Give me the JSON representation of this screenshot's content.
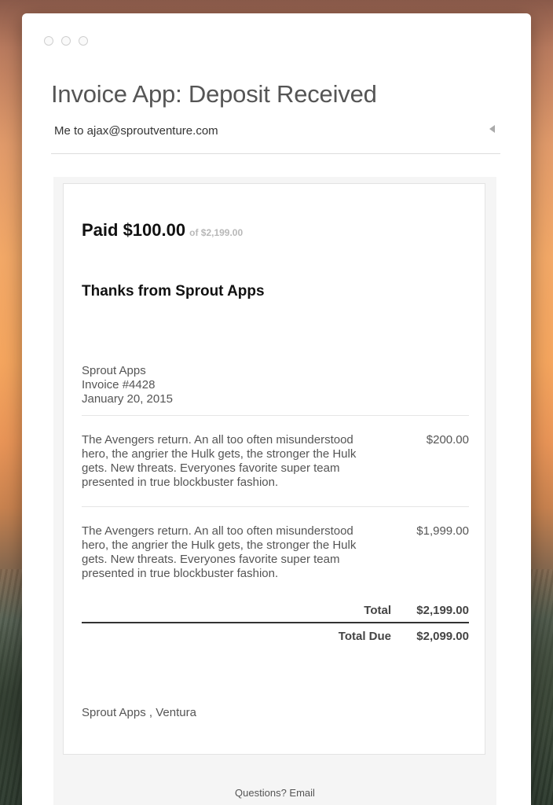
{
  "email": {
    "subject": "Invoice App: Deposit Received",
    "from_line": "Me to ajax@sproutventure.com"
  },
  "invoice": {
    "paid_amount": "Paid $100.00",
    "paid_of": "of $2,199.00",
    "thanks": "Thanks from Sprout Apps",
    "company": "Sprout Apps",
    "invoice_number": "Invoice #4428",
    "date": "January 20, 2015",
    "items": [
      {
        "description": "The Avengers return. An all too often misunderstood hero, the angrier the Hulk gets, the stronger the Hulk gets. New threats. Everyones favorite super team presented in true blockbuster fashion.",
        "price": "$200.00"
      },
      {
        "description": "The Avengers return. An all too often misunderstood hero, the angrier the Hulk gets, the stronger the Hulk gets. New threats. Everyones favorite super team presented in true blockbuster fashion.",
        "price": "$1,999.00"
      }
    ],
    "total_label": "Total",
    "total_value": "$2,199.00",
    "total_due_label": "Total Due",
    "total_due_value": "$2,099.00",
    "footer_company": "Sprout Apps , Ventura"
  },
  "footer": {
    "questions": "Questions? Email"
  },
  "icons": {
    "window_controls": [
      "close-icon",
      "minimize-icon",
      "zoom-icon"
    ],
    "reply": "reply-arrow-icon"
  }
}
